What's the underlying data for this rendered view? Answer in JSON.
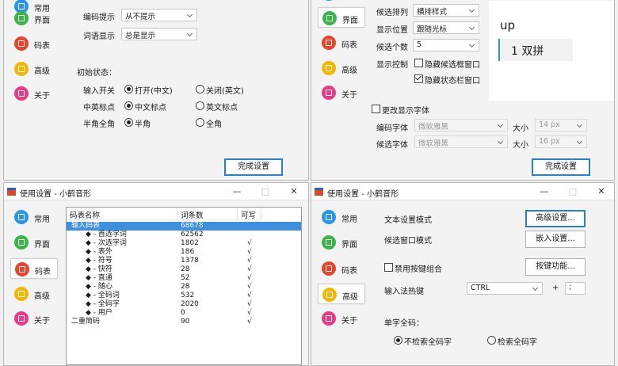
{
  "nav": {
    "common": "常用",
    "ui": "界面",
    "table": "码表",
    "advanced": "高级",
    "about": "关于"
  },
  "colors": {
    "common": "#2b95e9",
    "ui": "#3bb54a",
    "table": "#e8452c",
    "advanced": "#f2b705",
    "about": "#e63b86"
  },
  "window": {
    "title": "使用设置 - 小鹤音形"
  },
  "w1": {
    "code_hint_label": "编码提示",
    "code_hint": "从不提示",
    "word_hint_label": "词语显示",
    "word_hint": "总是显示",
    "init_state": "初始状态：",
    "rows": [
      {
        "label": "输入开关",
        "a": "打开(中文)",
        "b": "关闭(英文)"
      },
      {
        "label": "中英标点",
        "a": "中文标点",
        "b": "英文标点"
      },
      {
        "label": "半角全角",
        "a": "半角",
        "b": "全角"
      }
    ],
    "done": "完成设置"
  },
  "w2": {
    "arrange_label": "候选排列",
    "arrange": "横排样式",
    "pos_label": "显示位置",
    "pos": "跟随光标",
    "count_label": "候选个数",
    "count": "5",
    "ctrl_label": "显示控制",
    "hide_cand": "隐藏候选框窗口",
    "hide_status": "隐藏状态栏窗口",
    "preview_code": "up",
    "preview_cand": "1 双拼",
    "font_change": "更改显示字体",
    "code_font_label": "编码字体",
    "code_font": "微软雅黑",
    "cand_font_label": "候选字体",
    "cand_font": "微软雅黑",
    "size_label": "大小",
    "size1": "14 px",
    "size2": "16 px",
    "done": "完成设置"
  },
  "w3": {
    "headers": [
      "码表名称",
      "词条数",
      "可写"
    ],
    "rows": [
      {
        "name": "输入码表",
        "count": "68678",
        "w": ""
      },
      {
        "name": "◆ - 首选字词",
        "count": "62562",
        "w": ""
      },
      {
        "name": "◆ - 次选字词",
        "count": "1802",
        "w": "√"
      },
      {
        "name": "◆ - 表外",
        "count": "186",
        "w": "√"
      },
      {
        "name": "◆ - 符号",
        "count": "1378",
        "w": "√"
      },
      {
        "name": "◆ - 快符",
        "count": "28",
        "w": "√"
      },
      {
        "name": "◆ - 直通",
        "count": "52",
        "w": "√"
      },
      {
        "name": "◆ - 随心",
        "count": "28",
        "w": "√"
      },
      {
        "name": "◆ - 全码词",
        "count": "532",
        "w": "√"
      },
      {
        "name": "◆ - 全码字",
        "count": "2020",
        "w": "√"
      },
      {
        "name": "◆ - 用户",
        "count": "0",
        "w": "√"
      },
      {
        "name": "二重简码",
        "count": "90",
        "w": "√"
      }
    ]
  },
  "w4": {
    "text_mode": "文本设置模式",
    "adv_btn": "高级设置...",
    "cand_mode": "候选窗口模式",
    "embed_btn": "嵌入设置...",
    "disable_combo": "禁用按键组合",
    "key_btn": "按键功能...",
    "hotkey_label": "输入法热键",
    "hotkey": "CTRL",
    "plus": "+",
    "hotkey_char": ";",
    "single_label": "单字全码：",
    "no_search": "不检索全码字",
    "search": "检索全码字"
  }
}
